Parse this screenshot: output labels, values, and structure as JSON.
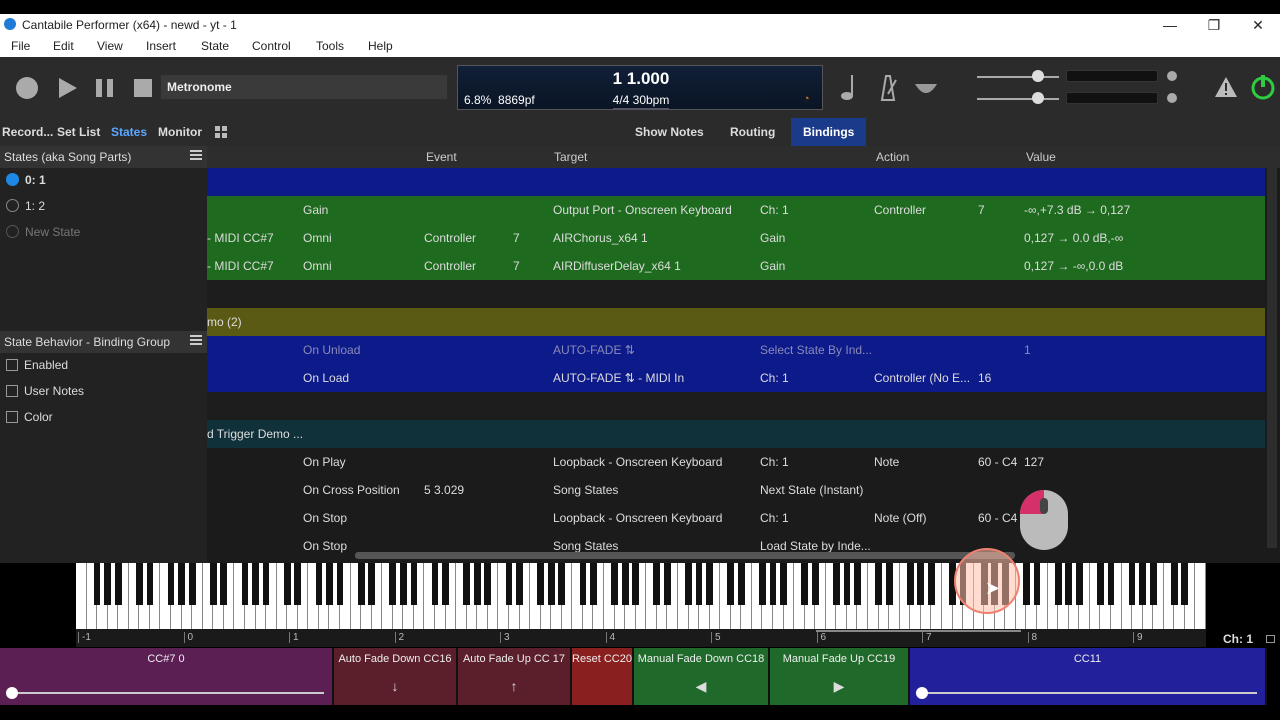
{
  "window": {
    "title": "Cantabile Performer (x64) - newd - yt - 1",
    "controls": [
      "—",
      "❐",
      "✕"
    ]
  },
  "menu": [
    "File",
    "Edit",
    "View",
    "Insert",
    "State",
    "Control",
    "Tools",
    "Help"
  ],
  "toolbar": {
    "metronome_label": "Metronome",
    "position": "1 1.000",
    "cpu": "6.8%",
    "sample_rate": "8869pf",
    "time_sig_tempo": "4/4 30bpm"
  },
  "left_tabs": [
    "Record...",
    "Set List",
    "States",
    "Monitor"
  ],
  "right_tabs": [
    "Show Notes",
    "Routing",
    "Bindings"
  ],
  "states_panel": {
    "title": "States (aka Song Parts)",
    "items": [
      {
        "label": "0: 1",
        "selected": true
      },
      {
        "label": "1: 2",
        "selected": false
      },
      {
        "label": "New State",
        "selected": false
      }
    ]
  },
  "behavior_panel": {
    "title": "State Behavior - Binding Group",
    "options": [
      "Enabled",
      "User Notes",
      "Color"
    ]
  },
  "columns": [
    "Event",
    "Target",
    "Action",
    "Value"
  ],
  "rows": [
    {
      "bg": "#0d1a8a",
      "cells": [
        ""
      ],
      "group": true
    },
    {
      "bg": "#1e6a1e",
      "cells": [
        "",
        "Gain",
        "",
        "",
        "Output Port - Onscreen Keyboard",
        "Ch: 1",
        "Controller",
        "7",
        "-∞,+7.3 dB → 0,127"
      ]
    },
    {
      "bg": "#1e6a1e",
      "cells": [
        "- MIDI CC#7",
        "Omni",
        "Controller",
        "7",
        "AIRChorus_x64 1",
        "Gain",
        "",
        "",
        "0,127 → 0.0 dB,-∞"
      ]
    },
    {
      "bg": "#1e6a1e",
      "cells": [
        "- MIDI CC#7",
        "Omni",
        "Controller",
        "7",
        "AIRDiffuserDelay_x64 1",
        "Gain",
        "",
        "",
        "0,127 → -∞,0.0 dB"
      ]
    },
    {
      "bg": "#1d1d1d",
      "cells": [
        ""
      ]
    },
    {
      "bg": "#5a5a14",
      "cells": [
        "mo (2)"
      ],
      "group": true
    },
    {
      "bg": "#0d1a8a",
      "dim": true,
      "cells": [
        "",
        "On Unload",
        "",
        "",
        "AUTO-FADE ⇅",
        "Select State By Ind...",
        "",
        "",
        "1"
      ]
    },
    {
      "bg": "#0d1a8a",
      "cells": [
        "",
        "On Load",
        "",
        "",
        "AUTO-FADE ⇅ - MIDI In",
        "Ch: 1",
        "Controller (No E...",
        "16",
        ""
      ]
    },
    {
      "bg": "#1d1d1d",
      "cells": [
        ""
      ]
    },
    {
      "bg": "#10303a",
      "cells": [
        "d Trigger Demo ..."
      ],
      "group": true
    },
    {
      "bg": "#1b1b1b",
      "cells": [
        "",
        "On Play",
        "",
        "",
        "Loopback - Onscreen Keyboard",
        "Ch: 1",
        "Note",
        "60 - C4",
        "127"
      ]
    },
    {
      "bg": "#1b1b1b",
      "cells": [
        "",
        "On Cross Position",
        "5 3.029",
        "",
        "Song States",
        "Next State (Instant)",
        "",
        "",
        ""
      ]
    },
    {
      "bg": "#1b1b1b",
      "cells": [
        "",
        "On Stop",
        "",
        "",
        "Loopback - Onscreen Keyboard",
        "Ch: 1",
        "Note (Off)",
        "60 - C4",
        ""
      ]
    },
    {
      "bg": "#1b1b1b",
      "cells": [
        "",
        "On Stop",
        "",
        "",
        "Song States",
        "Load State by Inde...",
        "",
        "",
        ""
      ]
    }
  ],
  "ruler": [
    "-1",
    "0",
    "1",
    "2",
    "3",
    "4",
    "5",
    "6",
    "7",
    "8",
    "9"
  ],
  "channel": "Ch: 1",
  "bottom_bar": [
    {
      "label": "CC#7 0",
      "color": "#5c1f54",
      "kind": "slider",
      "level": 0
    },
    {
      "label": "Auto Fade Down CC16",
      "color": "#5a1f2a",
      "symbol": "↓"
    },
    {
      "label": "Auto Fade Up CC 17",
      "color": "#5a1f2a",
      "symbol": "↑"
    },
    {
      "label": "Reset CC20",
      "color": "#8a1f1f",
      "symbol": ""
    },
    {
      "label": "Manual Fade Down CC18",
      "color": "#1f6a2a",
      "symbol": "◀"
    },
    {
      "label": "Manual Fade Up CC19",
      "color": "#1f6a2a",
      "symbol": "▶"
    },
    {
      "label": "CC11",
      "color": "#22209a",
      "kind": "slider",
      "level": 0
    }
  ]
}
